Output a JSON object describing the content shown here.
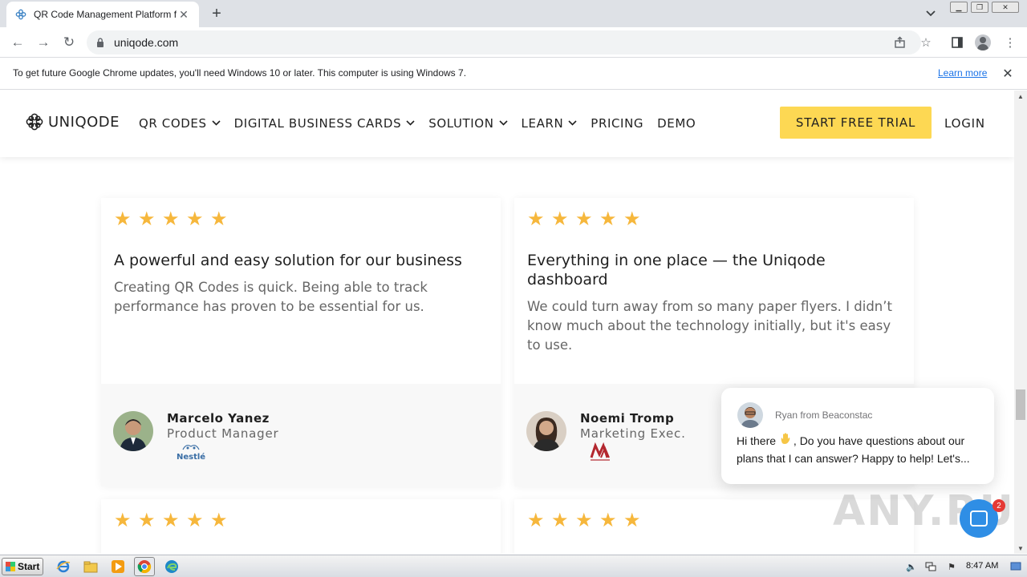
{
  "browser": {
    "tab_title": "QR Code Management Platform for r",
    "url": "uniqode.com",
    "window_controls": [
      "minimize",
      "restore",
      "close"
    ]
  },
  "infobar": {
    "message": "To get future Google Chrome updates, you'll need Windows 10 or later. This computer is using Windows 7.",
    "link": "Learn more"
  },
  "site": {
    "logo_text": "UNIQODE",
    "nav": [
      {
        "label": "QR CODES",
        "dropdown": true
      },
      {
        "label": "DIGITAL BUSINESS CARDS",
        "dropdown": true
      },
      {
        "label": "SOLUTION",
        "dropdown": true
      },
      {
        "label": "LEARN",
        "dropdown": true
      },
      {
        "label": "PRICING",
        "dropdown": false
      },
      {
        "label": "DEMO",
        "dropdown": false
      }
    ],
    "cta": "START FREE TRIAL",
    "login": "LOGIN",
    "brand_color": "#fdd853"
  },
  "testimonials": [
    {
      "rating": 5,
      "title": "A powerful and easy solution for our business",
      "body": "Creating QR Codes is quick. Being able to track performance has proven to be essential for us.",
      "name": "Marcelo Yanez",
      "role": "Product Manager",
      "company_logo": "Nestle"
    },
    {
      "rating": 5,
      "title": "Everything in one place — the Uniqode dashboard",
      "body": "We could turn away from so many paper flyers. I didn’t know much about the technology initially, but it's easy to use.",
      "name": "Noemi Tromp",
      "role": "Marketing Exec.",
      "company_logo": "Marriott"
    },
    {
      "rating": 5
    },
    {
      "rating": 5
    }
  ],
  "chat": {
    "from": "Ryan from Beaconstac",
    "message_start": "Hi there",
    "message_rest": ", Do you have questions about our plans that I can answer? Happy to help! Let's...",
    "badge_count": "2"
  },
  "watermark": "ANY.RUN",
  "taskbar": {
    "start_label": "Start",
    "clock": "8:47 AM"
  }
}
